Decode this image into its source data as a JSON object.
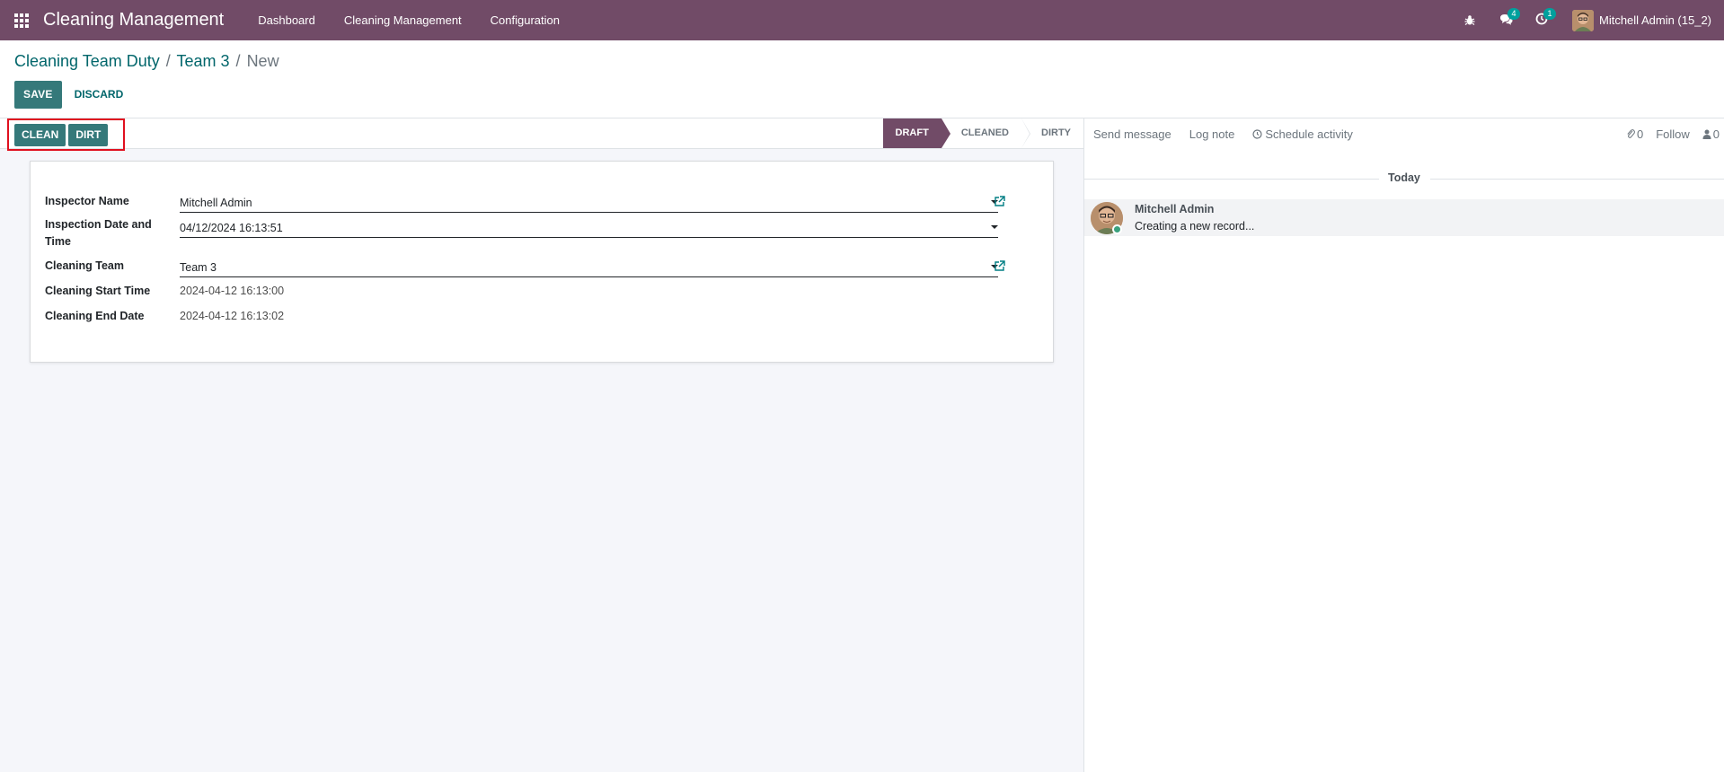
{
  "navbar": {
    "app_title": "Cleaning Management",
    "menu": [
      {
        "label": "Dashboard"
      },
      {
        "label": "Cleaning Management"
      },
      {
        "label": "Configuration"
      }
    ],
    "messages_count": "4",
    "activities_count": "1",
    "user_name": "Mitchell Admin (15_2)",
    "accent": "#714B67"
  },
  "breadcrumb": {
    "items": [
      "Cleaning Team Duty",
      "Team 3"
    ],
    "current": "New",
    "separator": "/"
  },
  "control": {
    "save_label": "SAVE",
    "discard_label": "DISCARD"
  },
  "header_buttons": {
    "clean_label": "CLEAN",
    "dirt_label": "DIRT"
  },
  "statusbar": {
    "stages": [
      "DRAFT",
      "CLEANED",
      "DIRTY"
    ],
    "active": "DRAFT"
  },
  "form": {
    "inspector_name": {
      "label": "Inspector Name",
      "value": "Mitchell Admin"
    },
    "inspection_datetime": {
      "label_line1": "Inspection Date and",
      "label_line2": "Time",
      "value": "04/12/2024 16:13:51"
    },
    "cleaning_team": {
      "label": "Cleaning Team",
      "value": "Team 3"
    },
    "start_time": {
      "label": "Cleaning Start Time",
      "value": "2024-04-12 16:13:00"
    },
    "end_date": {
      "label": "Cleaning End Date",
      "value": "2024-04-12 16:13:02"
    }
  },
  "chatter": {
    "send_message": "Send message",
    "log_note": "Log note",
    "schedule_activity": "Schedule activity",
    "attachments_count": "0",
    "follow": "Follow",
    "followers_count": "0",
    "date_separator": "Today",
    "message": {
      "author": "Mitchell Admin",
      "body": "Creating a new record..."
    }
  }
}
